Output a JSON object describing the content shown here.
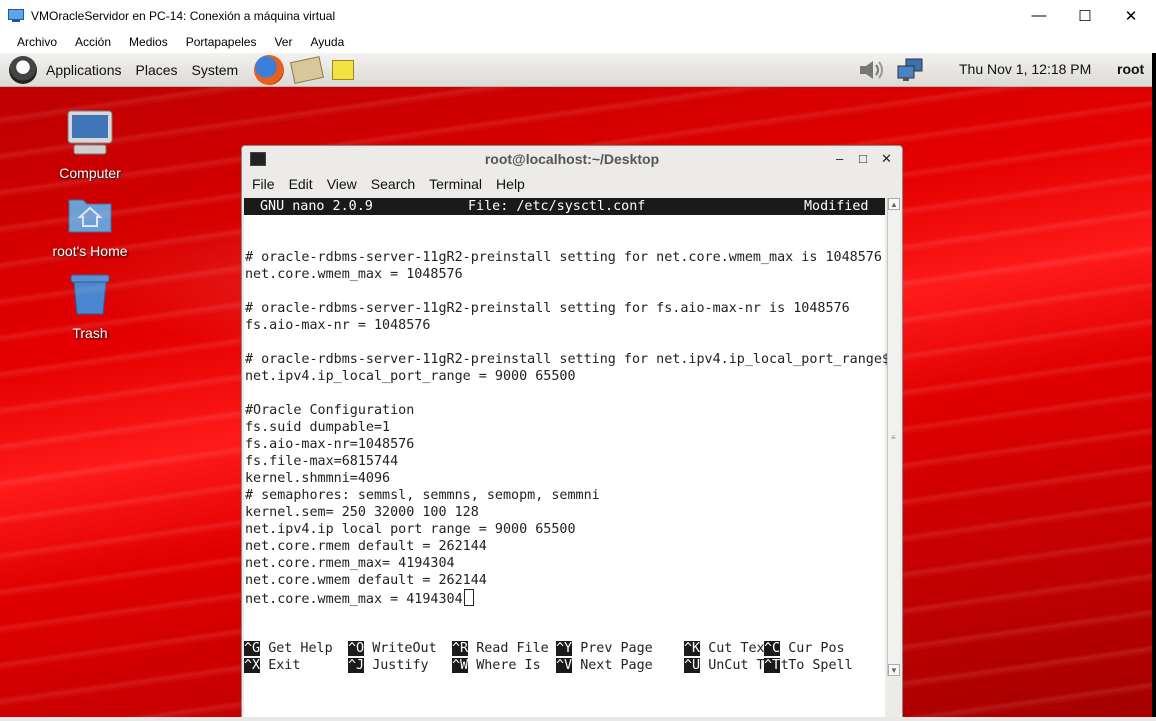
{
  "host": {
    "title": "VMOracleServidor en PC-14: Conexión a máquina virtual",
    "controls": {
      "minimize": "—",
      "maximize": "☐",
      "close": "✕"
    },
    "menu": [
      "Archivo",
      "Acción",
      "Medios",
      "Portapapeles",
      "Ver",
      "Ayuda"
    ]
  },
  "panel": {
    "menus": [
      "Applications",
      "Places",
      "System"
    ],
    "clock": "Thu Nov  1, 12:18 PM",
    "user": "root"
  },
  "desktop": {
    "icons": [
      {
        "label": "Computer",
        "icon": "computer-icon"
      },
      {
        "label": "root's Home",
        "icon": "home-folder-icon"
      },
      {
        "label": "Trash",
        "icon": "trash-icon"
      }
    ]
  },
  "terminal": {
    "title": "root@localhost:~/Desktop",
    "controls": {
      "minimize": "–",
      "maximize": "□",
      "close": "✕"
    },
    "menu": [
      "File",
      "Edit",
      "View",
      "Search",
      "Terminal",
      "Help"
    ],
    "nano": {
      "version": "GNU nano 2.0.9",
      "file": "File: /etc/sysctl.conf",
      "status": "Modified",
      "lines": [
        "",
        "",
        "# oracle-rdbms-server-11gR2-preinstall setting for net.core.wmem_max is 1048576",
        "net.core.wmem_max = 1048576",
        "",
        "# oracle-rdbms-server-11gR2-preinstall setting for fs.aio-max-nr is 1048576",
        "fs.aio-max-nr = 1048576",
        "",
        "# oracle-rdbms-server-11gR2-preinstall setting for net.ipv4.ip_local_port_range$",
        "net.ipv4.ip_local_port_range = 9000 65500",
        "",
        "#Oracle Configuration",
        "fs.suid dumpable=1",
        "fs.aio-max-nr=1048576",
        "fs.file-max=6815744",
        "kernel.shmmni=4096",
        "# semaphores: semmsl, semmns, semopm, semmni",
        "kernel.sem= 250 32000 100 128",
        "net.ipv4.ip local port range = 9000 65500",
        "net.core.rmem default = 262144",
        "net.core.rmem_max= 4194304",
        "net.core.wmem default = 262144",
        "net.core.wmem_max = 4194304"
      ],
      "shortcuts_row1": [
        {
          "key": "^G",
          "label": "Get Help"
        },
        {
          "key": "^O",
          "label": "WriteOut"
        },
        {
          "key": "^R",
          "label": "Read File"
        },
        {
          "key": "^Y",
          "label": "Prev Page"
        },
        {
          "key": "^K",
          "label": "Cut Text"
        },
        {
          "key": "^C",
          "label": "Cur Pos"
        }
      ],
      "shortcuts_row2": [
        {
          "key": "^X",
          "label": "Exit"
        },
        {
          "key": "^J",
          "label": "Justify"
        },
        {
          "key": "^W",
          "label": "Where Is"
        },
        {
          "key": "^V",
          "label": "Next Page"
        },
        {
          "key": "^U",
          "label": "UnCut Text"
        },
        {
          "key": "^T",
          "label": "To Spell"
        }
      ]
    }
  }
}
